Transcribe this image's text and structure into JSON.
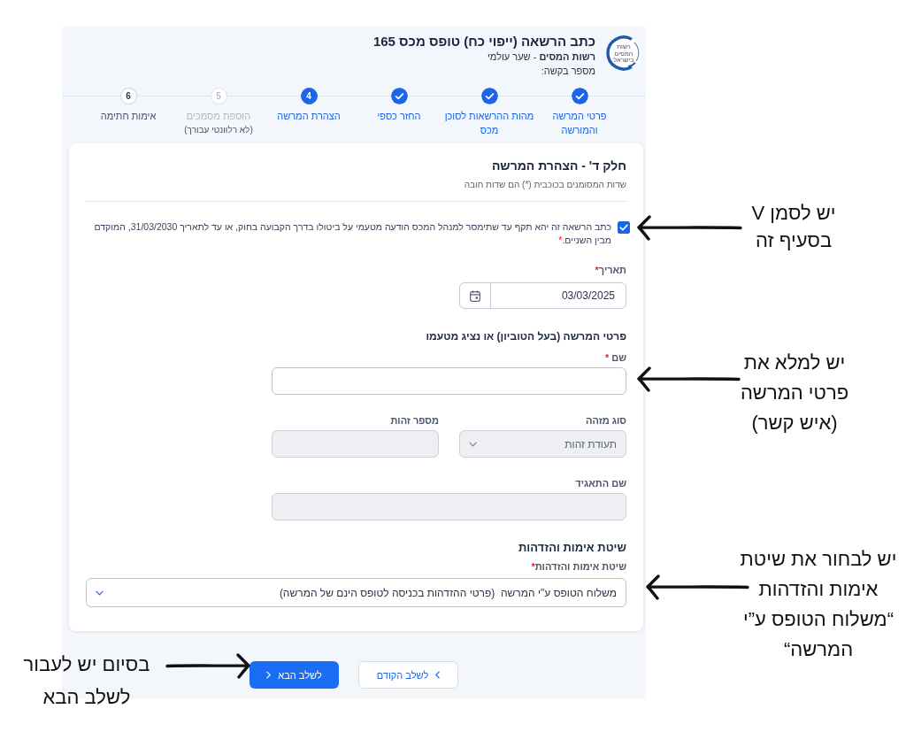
{
  "header": {
    "logo_text": "רשות המסים בישראל",
    "title": "כתב הרשאה (ייפוי כח) טופס מכס 165",
    "subtitle": "**רשות המסים** - שער עולמי",
    "request_label": "מספר בקשה:"
  },
  "steps": [
    {
      "label": "פרטי המרשה\nוהמורשה",
      "completed": true,
      "selected": false,
      "disabled": false
    },
    {
      "label": "מהות ההרשאות לסוכן\nמכס",
      "completed": true,
      "selected": false,
      "disabled": false
    },
    {
      "label": "החזר כספי",
      "completed": true,
      "selected": false,
      "disabled": false
    },
    {
      "number": "4",
      "label": "הצהרת המרשה",
      "completed": false,
      "selected": true,
      "disabled": false
    },
    {
      "number": "5",
      "label": "הוספת מסמכים",
      "note": "(לא רלוונטי עבורך)",
      "completed": false,
      "selected": false,
      "disabled": true
    },
    {
      "number": "6",
      "label": "אימות חתימה",
      "completed": false,
      "selected": false,
      "disabled": false
    }
  ],
  "form": {
    "title": "חלק ד' - הצהרת המרשה",
    "subtitle": "שדות המסומנים בכוכבית (*) הם שדות חובה",
    "declaration": {
      "checked": true,
      "text": "כתב הרשאה זה יהא תקף עד שתימסר למנהל המכס הודעה מטעמי על ביטולו בדרך הקבועה בחוק, או עד לתאריך 31/03/2030, המוקדם מבין השניים.",
      "required_mark": "*"
    },
    "date": {
      "label": "תאריך",
      "required_mark": "*",
      "value": "03/03/2025"
    },
    "principal": {
      "heading": "פרטי המרשה (בעל הטוביון) או נציג מטעמו",
      "rows": [
        [
          {
            "kind": "text",
            "label": "שם",
            "required_mark": "*",
            "disabled": false
          }
        ],
        [
          {
            "kind": "select",
            "label": "סוג מזהה",
            "value": "תעודת זהות",
            "disabled": true
          },
          {
            "kind": "text",
            "label": "מספר זהות",
            "disabled": true
          }
        ],
        [
          {
            "kind": "text",
            "label": "שם התאגיד",
            "disabled": true
          }
        ]
      ]
    },
    "verification": {
      "heading": "שיטת אימות והזדהות",
      "field": {
        "kind": "select",
        "label": "שיטת אימות והזדהות",
        "required_mark": "*",
        "value": "משלוח הטופס ע\"י המרשה  (פרטי ההזדהות בכניסה לטופס הינם של המרשה)",
        "disabled": false
      }
    }
  },
  "buttons": [
    {
      "kind": "secondary",
      "label": "לשלב הקודם"
    },
    {
      "kind": "primary",
      "label": "לשלב הבא"
    }
  ],
  "annotations": [
    {
      "text": "יש לסמן V\nבסעיף זה"
    },
    {
      "text": "יש למלא את\nפרטי המרשה\n(איש קשר)"
    },
    {
      "text": "יש לבחור את שיטת\nאימות והזדהות\n“משלוח הטופס ע”י\nהמרשה“"
    },
    {
      "text": "בסיום יש לעבור\nלשלב הבא"
    }
  ]
}
